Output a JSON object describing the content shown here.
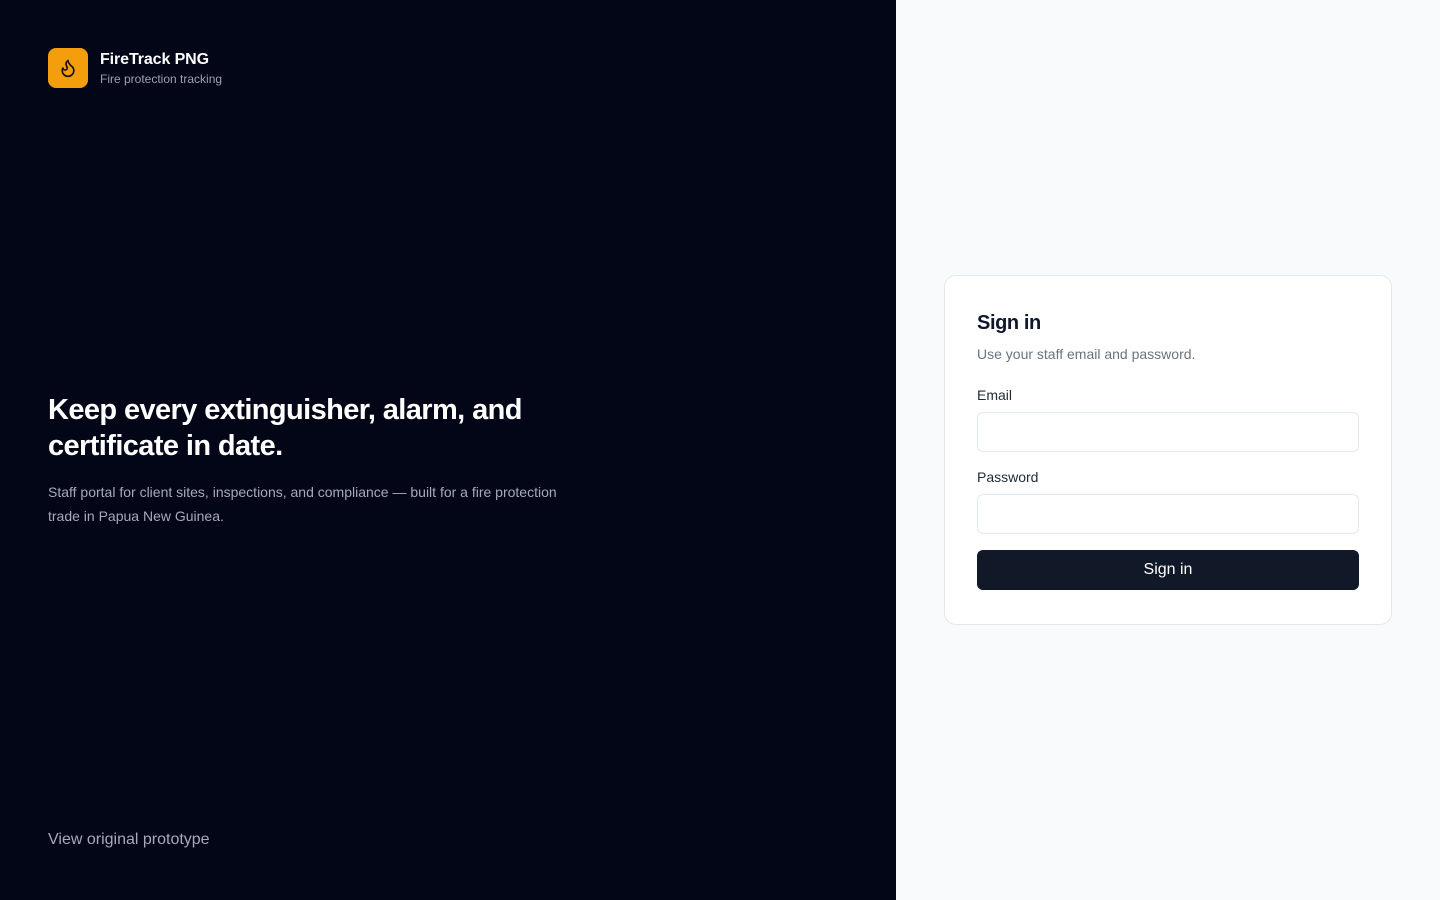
{
  "brand": {
    "name": "FireTrack PNG",
    "tagline": "Fire protection tracking",
    "logo_icon": "flame-icon",
    "accent_color": "#f59e0b"
  },
  "hero": {
    "title": "Keep every extinguisher, alarm, and certificate in date.",
    "subtitle": "Staff portal for client sites, inspections, and compliance — built for a fire protection trade in Papua New Guinea."
  },
  "footer": {
    "prototype_link": "View original prototype"
  },
  "login": {
    "title": "Sign in",
    "subtitle": "Use your staff email and password.",
    "email_label": "Email",
    "email_value": "",
    "password_label": "Password",
    "password_value": "",
    "submit_label": "Sign in",
    "button_color": "#111827"
  }
}
